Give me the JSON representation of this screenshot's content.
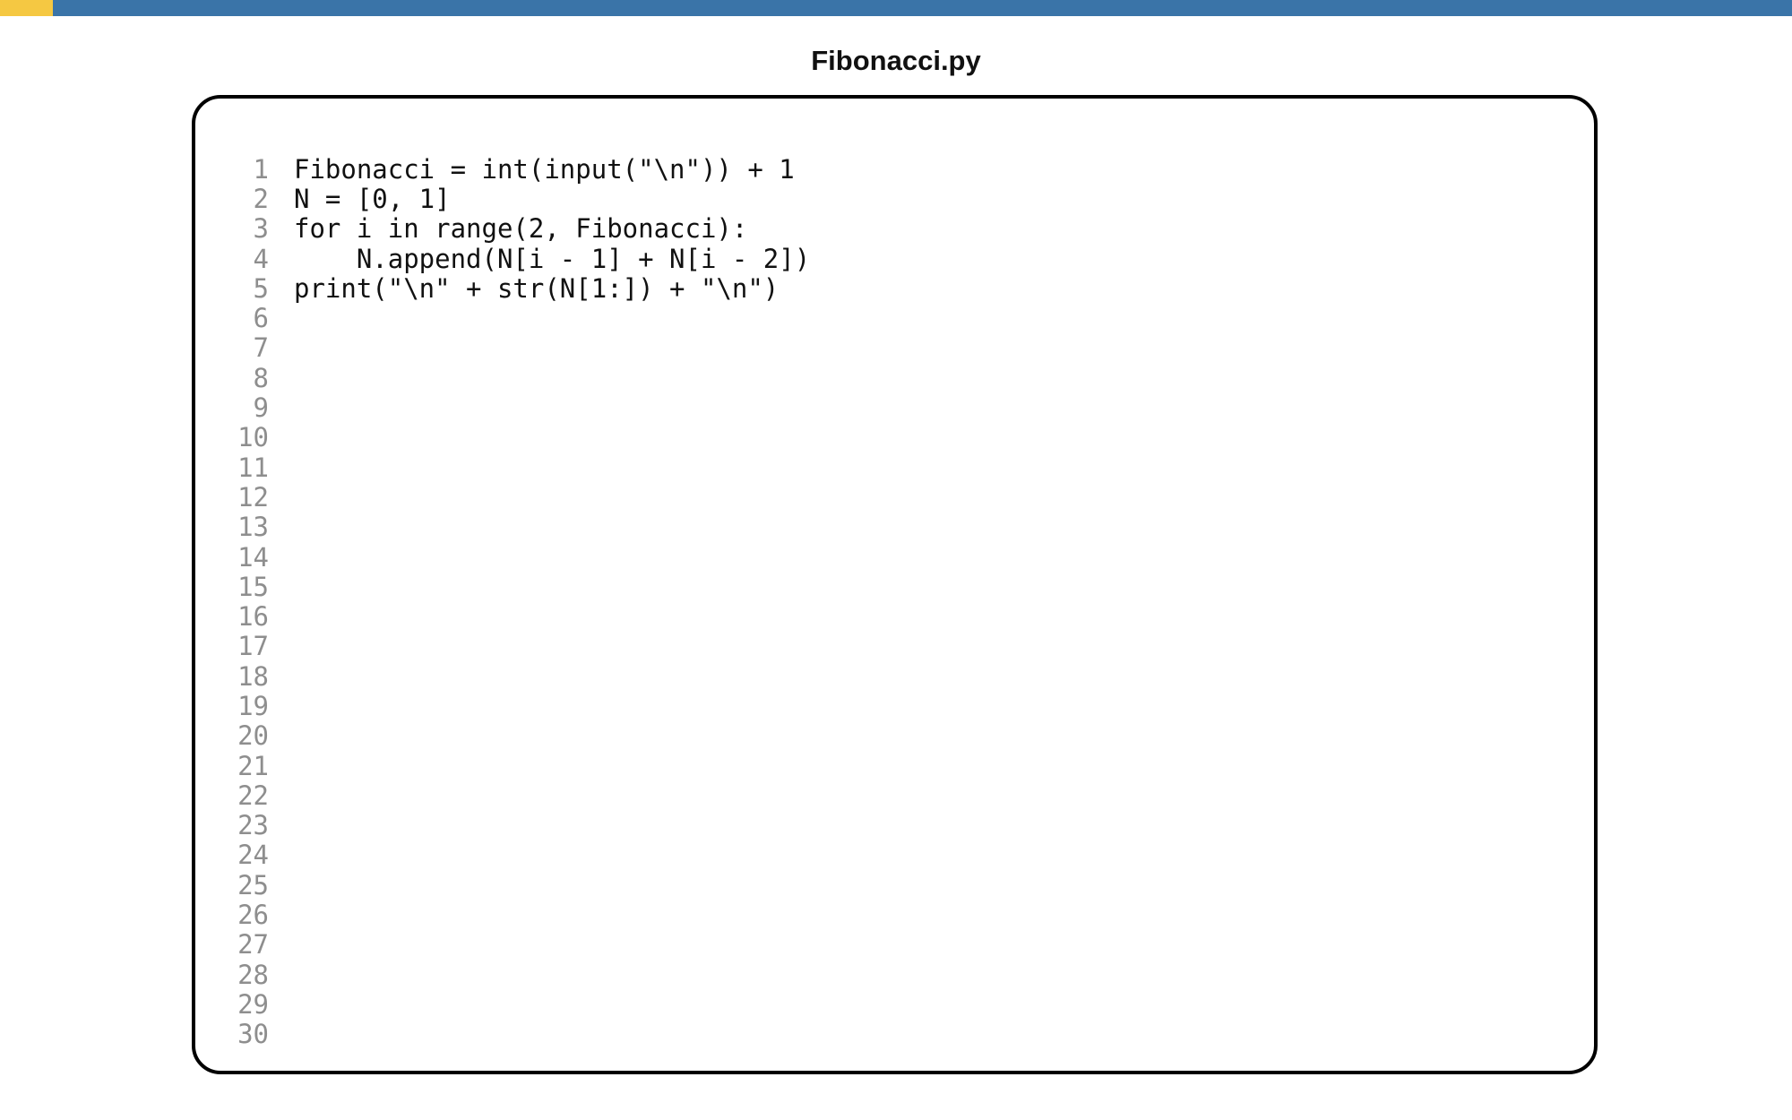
{
  "window": {
    "title": "Fibonacci.py"
  },
  "colors": {
    "topbar": "#3a74a8",
    "accent": "#f5c842",
    "line_numbers": "#8e8e8e",
    "code_text": "#111111",
    "border": "#000000"
  },
  "editor": {
    "lines": [
      {
        "number": "1",
        "code": "Fibonacci = int(input(\"\\n\")) + 1"
      },
      {
        "number": "2",
        "code": "N = [0, 1]"
      },
      {
        "number": "3",
        "code": "for i in range(2, Fibonacci):"
      },
      {
        "number": "4",
        "code": "    N.append(N[i - 1] + N[i - 2])"
      },
      {
        "number": "5",
        "code": "print(\"\\n\" + str(N[1:]) + \"\\n\")"
      },
      {
        "number": "6",
        "code": ""
      },
      {
        "number": "7",
        "code": ""
      },
      {
        "number": "8",
        "code": ""
      },
      {
        "number": "9",
        "code": ""
      },
      {
        "number": "10",
        "code": ""
      },
      {
        "number": "11",
        "code": ""
      },
      {
        "number": "12",
        "code": ""
      },
      {
        "number": "13",
        "code": ""
      },
      {
        "number": "14",
        "code": ""
      },
      {
        "number": "15",
        "code": ""
      },
      {
        "number": "16",
        "code": ""
      },
      {
        "number": "17",
        "code": ""
      },
      {
        "number": "18",
        "code": ""
      },
      {
        "number": "19",
        "code": ""
      },
      {
        "number": "20",
        "code": ""
      },
      {
        "number": "21",
        "code": ""
      },
      {
        "number": "22",
        "code": ""
      },
      {
        "number": "23",
        "code": ""
      },
      {
        "number": "24",
        "code": ""
      },
      {
        "number": "25",
        "code": ""
      },
      {
        "number": "26",
        "code": ""
      },
      {
        "number": "27",
        "code": ""
      },
      {
        "number": "28",
        "code": ""
      },
      {
        "number": "29",
        "code": ""
      },
      {
        "number": "30",
        "code": ""
      }
    ]
  }
}
